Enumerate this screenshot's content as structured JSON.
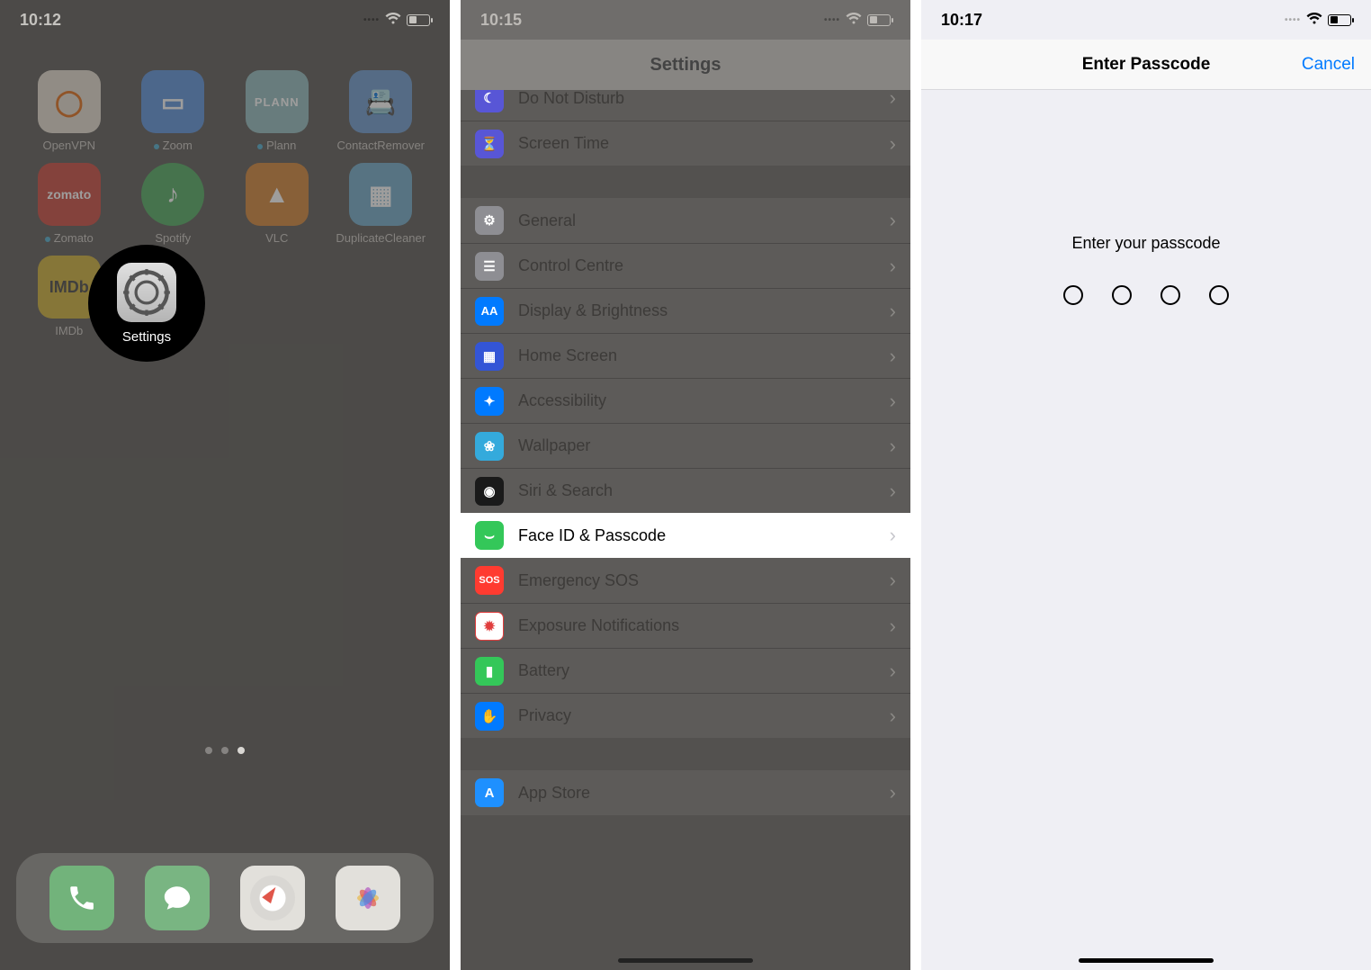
{
  "screen1": {
    "time": "10:12",
    "apps": [
      {
        "label": "OpenVPN",
        "dot": false
      },
      {
        "label": "Zoom",
        "dot": true
      },
      {
        "label": "Plann",
        "dot": true
      },
      {
        "label": "ContactRemover",
        "dot": false
      },
      {
        "label": "Zomato",
        "dot": true
      },
      {
        "label": "Spotify",
        "dot": false
      },
      {
        "label": "VLC",
        "dot": false
      },
      {
        "label": "DuplicateCleaner",
        "dot": false
      },
      {
        "label": "IMDb",
        "dot": false
      }
    ],
    "plann_text": "PLANN",
    "imdb_text": "IMDb",
    "spotlight_label": "Settings"
  },
  "screen2": {
    "time": "10:15",
    "title": "Settings",
    "rows": [
      {
        "label": "Do Not Disturb"
      },
      {
        "label": "Screen Time"
      },
      {
        "label": "General"
      },
      {
        "label": "Control Centre"
      },
      {
        "label": "Display & Brightness"
      },
      {
        "label": "Home Screen"
      },
      {
        "label": "Accessibility"
      },
      {
        "label": "Wallpaper"
      },
      {
        "label": "Siri & Search"
      },
      {
        "label": "Face ID & Passcode"
      },
      {
        "label": "Emergency SOS"
      },
      {
        "label": "Exposure Notifications"
      },
      {
        "label": "Battery"
      },
      {
        "label": "Privacy"
      },
      {
        "label": "App Store"
      }
    ],
    "sos_text": "SOS"
  },
  "screen3": {
    "time": "10:17",
    "title": "Enter Passcode",
    "cancel": "Cancel",
    "prompt": "Enter your passcode",
    "digits": 4
  }
}
